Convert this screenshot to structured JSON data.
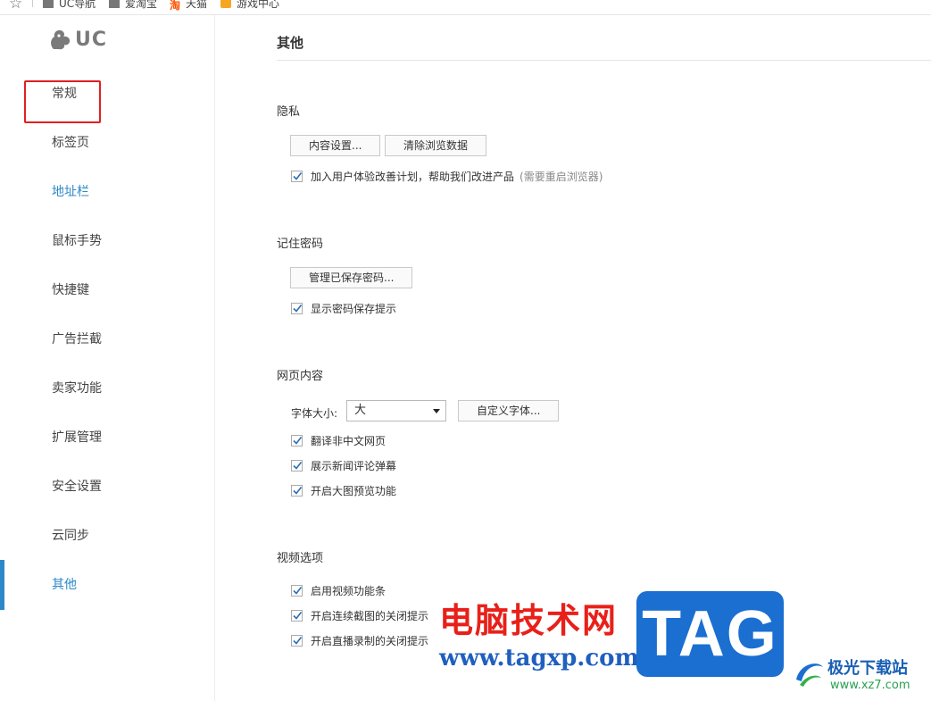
{
  "bookmarks": {
    "items": [
      {
        "label": "UC导航",
        "icon": "folder-icon"
      },
      {
        "label": "爱淘宝",
        "icon": "folder-icon"
      },
      {
        "label": "天猫",
        "icon": "taobao-icon"
      },
      {
        "label": "游戏中心",
        "icon": "game-icon"
      }
    ]
  },
  "sidebar": {
    "logo_text": "UC",
    "items": [
      {
        "label": "常规"
      },
      {
        "label": "标签页"
      },
      {
        "label": "地址栏"
      },
      {
        "label": "鼠标手势"
      },
      {
        "label": "快捷键"
      },
      {
        "label": "广告拦截"
      },
      {
        "label": "卖家功能"
      },
      {
        "label": "扩展管理"
      },
      {
        "label": "安全设置"
      },
      {
        "label": "云同步"
      },
      {
        "label": "其他"
      }
    ],
    "current": "其他"
  },
  "content": {
    "page_title": "其他",
    "privacy": {
      "title": "隐私",
      "content_settings_btn": "内容设置...",
      "clear_data_btn": "清除浏览数据",
      "ux_plan_label": "加入用户体验改善计划，帮助我们改进产品",
      "ux_plan_hint": "(需要重启浏览器)",
      "ux_plan_checked": true
    },
    "passwords": {
      "title": "记住密码",
      "manage_btn": "管理已保存密码...",
      "show_prompt_label": "显示密码保存提示",
      "show_prompt_checked": true
    },
    "webcontent": {
      "title": "网页内容",
      "font_size_label": "字体大小:",
      "font_size_value": "大",
      "custom_font_btn": "自定义字体...",
      "translate_label": "翻译非中文网页",
      "news_comments_label": "展示新闻评论弹幕",
      "image_preview_label": "开启大图预览功能"
    },
    "video": {
      "title": "视频选项",
      "video_bar_label": "启用视频功能条",
      "screenshot_prompt_label": "开启连续截图的关闭提示",
      "recording_prompt_label": "开启直播录制的关闭提示"
    }
  },
  "watermark": {
    "cn_text": "电脑技术网",
    "tag_text": "TAG",
    "url_text": "www.tagxp.com",
    "brand_text": "极光下载站",
    "brand_url": "www.xz7.com"
  },
  "colors": {
    "accent": "#2c88c8",
    "highlight_red": "#e02020",
    "watermark_red": "#e8201a",
    "watermark_blue": "#1a6fd1"
  }
}
